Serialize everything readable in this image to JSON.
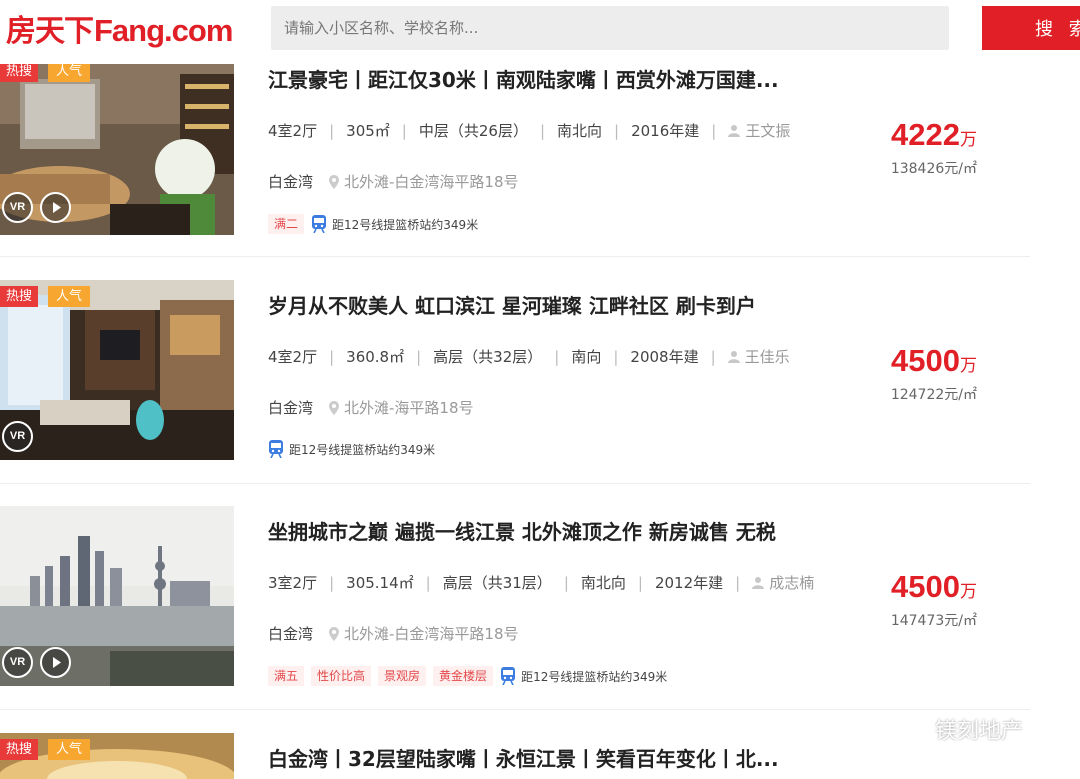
{
  "brand": {
    "logo_cn": "房天下",
    "logo_en": "Fang.com",
    "color": "#e02026"
  },
  "search": {
    "placeholder": "请输入小区名称、学校名称...",
    "button": "搜 索"
  },
  "listings": [
    {
      "tag_hot": "热搜",
      "tag_pop": "人气",
      "title": "江景豪宅丨距江仅30米丨南观陆家嘴丨西赏外滩万国建...",
      "rooms": "4室2厅",
      "area": "305㎡",
      "floor": "中层（共26层）",
      "orientation": "南北向",
      "year": "2016年建",
      "agent": "王文振",
      "community": "白金湾",
      "address": "北外滩-白金湾海平路18号",
      "chips": [
        "满二"
      ],
      "metro": "距12号线提篮桥站约349米",
      "price": "4222",
      "price_unit": "万",
      "unit_price": "138426元/㎡",
      "has_play": true
    },
    {
      "tag_hot": "热搜",
      "tag_pop": "人气",
      "title": "岁月从不败美人 虹口滨江 星河璀璨 江畔社区 刷卡到户",
      "rooms": "4室2厅",
      "area": "360.8㎡",
      "floor": "高层（共32层）",
      "orientation": "南向",
      "year": "2008年建",
      "agent": "王佳乐",
      "community": "白金湾",
      "address": "北外滩-海平路18号",
      "chips": [],
      "metro": "距12号线提篮桥站约349米",
      "price": "4500",
      "price_unit": "万",
      "unit_price": "124722元/㎡",
      "has_play": false
    },
    {
      "tag_hot": "",
      "tag_pop": "",
      "title": "坐拥城市之巅 遍揽一线江景 北外滩顶之作 新房诚售 无税",
      "rooms": "3室2厅",
      "area": "305.14㎡",
      "floor": "高层（共31层）",
      "orientation": "南北向",
      "year": "2012年建",
      "agent": "成志楠",
      "community": "白金湾",
      "address": "北外滩-白金湾海平路18号",
      "chips": [
        "满五",
        "性价比高",
        "景观房",
        "黄金楼层"
      ],
      "metro": "距12号线提篮桥站约349米",
      "price": "4500",
      "price_unit": "万",
      "unit_price": "147473元/㎡",
      "has_play": true
    },
    {
      "tag_hot": "热搜",
      "tag_pop": "人气",
      "title": "白金湾丨32层望陆家嘴丨永恒江景丨笑看百年变化丨北..."
    }
  ],
  "watermark": "镁刻地产",
  "icons": {
    "vr": "VR",
    "play": "play-icon",
    "pin": "location-pin-icon",
    "metro": "metro-icon",
    "agent": "person-icon"
  }
}
